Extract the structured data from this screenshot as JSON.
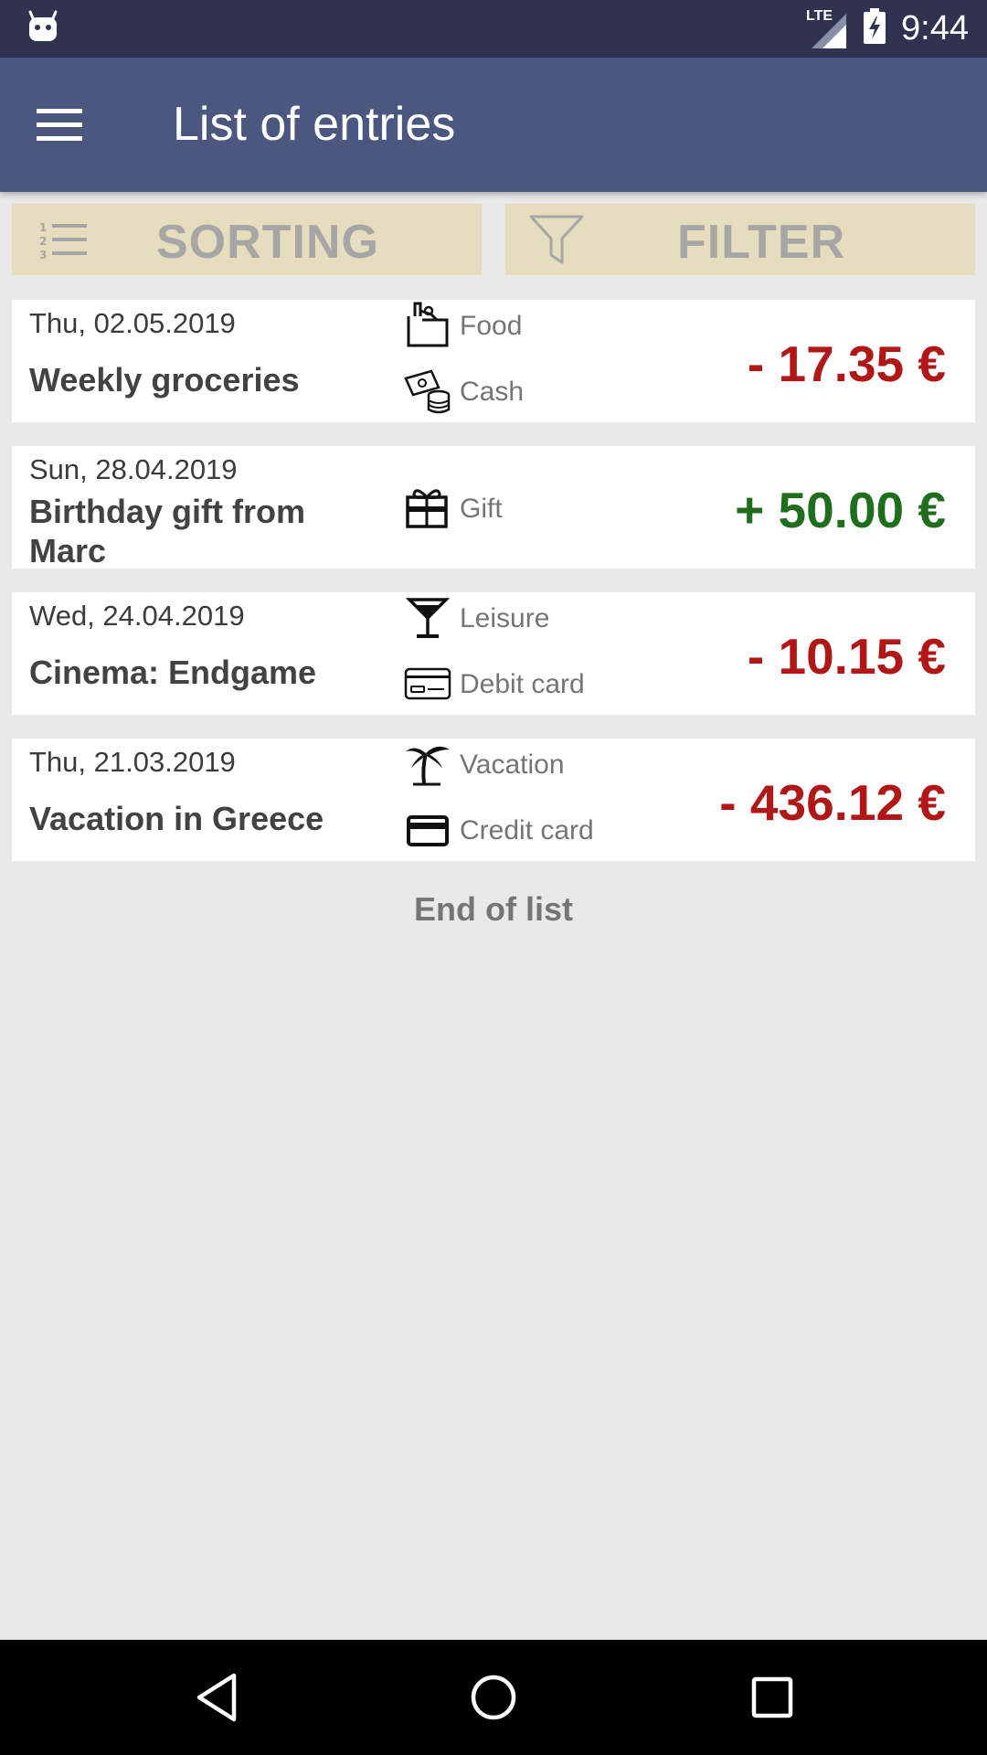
{
  "status_bar": {
    "network": "LTE",
    "time": "9:44"
  },
  "app_bar": {
    "title": "List of entries",
    "menu_icon": "hamburger-menu-icon"
  },
  "toolbar": {
    "sorting_label": "SORTING",
    "filter_label": "FILTER"
  },
  "entries": [
    {
      "date": "Thu, 02.05.2019",
      "description": "Weekly groceries",
      "category": "Food",
      "category_icon": "food-bag-icon",
      "payment": "Cash",
      "payment_icon": "cash-icon",
      "amount": "- 17.35 €",
      "type": "expense"
    },
    {
      "date": "Sun, 28.04.2019",
      "description": "Birthday gift from Marc",
      "category": "Gift",
      "category_icon": "gift-icon",
      "amount": "+ 50.00 €",
      "type": "income"
    },
    {
      "date": "Wed, 24.04.2019",
      "description": "Cinema: Endgame",
      "category": "Leisure",
      "category_icon": "cocktail-glass-icon",
      "payment": "Debit card",
      "payment_icon": "debit-card-icon",
      "amount": "- 10.15 €",
      "type": "expense"
    },
    {
      "date": "Thu, 21.03.2019",
      "description": "Vacation in Greece",
      "category": "Vacation",
      "category_icon": "palm-tree-icon",
      "payment": "Credit card",
      "payment_icon": "credit-card-icon",
      "amount": "- 436.12 €",
      "type": "expense"
    }
  ],
  "footer": {
    "end_of_list": "End of list"
  },
  "colors": {
    "expense": "#b01717",
    "income": "#1e6e1e",
    "app_bar": "#4c577f",
    "status_bar": "#2f3350",
    "button_bg": "#e6ddbf"
  }
}
